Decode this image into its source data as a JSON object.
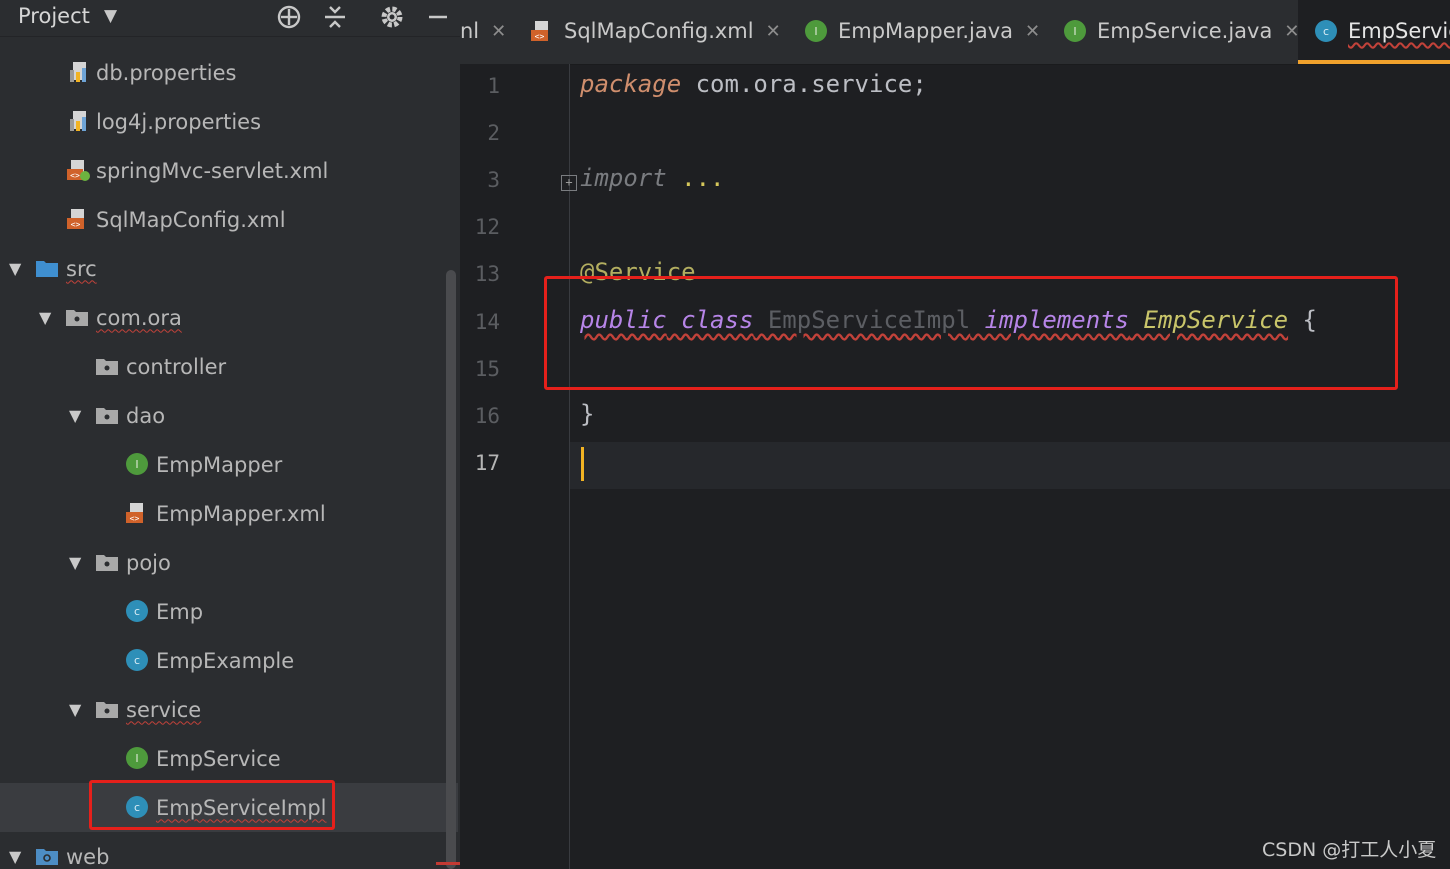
{
  "project_panel": {
    "title": "Project",
    "tree": [
      {
        "label": "db.properties",
        "icon": "properties-icon"
      },
      {
        "label": "log4j.properties",
        "icon": "properties-icon"
      },
      {
        "label": "springMvc-servlet.xml",
        "icon": "spring-xml-icon"
      },
      {
        "label": "SqlMapConfig.xml",
        "icon": "xml-icon"
      },
      {
        "label": "src",
        "icon": "source-folder-icon"
      },
      {
        "label": "com.ora",
        "icon": "package-icon"
      },
      {
        "label": "controller",
        "icon": "package-icon"
      },
      {
        "label": "dao",
        "icon": "package-icon"
      },
      {
        "label": "EmpMapper",
        "icon": "interface-icon"
      },
      {
        "label": "EmpMapper.xml",
        "icon": "xml-icon"
      },
      {
        "label": "pojo",
        "icon": "package-icon"
      },
      {
        "label": "Emp",
        "icon": "class-icon"
      },
      {
        "label": "EmpExample",
        "icon": "class-icon"
      },
      {
        "label": "service",
        "icon": "package-icon"
      },
      {
        "label": "EmpService",
        "icon": "interface-icon"
      },
      {
        "label": "EmpServiceImpl",
        "icon": "class-icon"
      },
      {
        "label": "web",
        "icon": "web-folder-icon"
      }
    ]
  },
  "editor": {
    "tabs": [
      {
        "label": "nl",
        "icon": ""
      },
      {
        "label": "SqlMapConfig.xml",
        "icon": "xml-icon"
      },
      {
        "label": "EmpMapper.java",
        "icon": "interface-icon"
      },
      {
        "label": "EmpService.java",
        "icon": "interface-icon"
      },
      {
        "label": "EmpServic",
        "icon": "class-icon"
      }
    ],
    "line_numbers": [
      "1",
      "2",
      "3",
      "12",
      "13",
      "14",
      "15",
      "16",
      "17"
    ],
    "code": {
      "l1_kw": "package",
      "l1_rest": " com.ora.service;",
      "l3_kw": "import",
      "l3_rest": " ...",
      "l13": "@Service",
      "l14_public": "public",
      "l14_class": " class",
      "l14_name": " EmpServiceImpl",
      "l14_impl": " implements",
      "l14_iface": " EmpService",
      "l14_brace": " {",
      "l16": "}"
    }
  },
  "watermark": "CSDN @打工人小夏",
  "colors": {
    "highlight_box": "#e5201b",
    "keyword": "#cf8e6d",
    "keyword_alt": "#b785e8",
    "active_tab_underline": "#f0a12c",
    "interface_icon": "#4e9a3c",
    "class_icon": "#2e8fb8"
  }
}
